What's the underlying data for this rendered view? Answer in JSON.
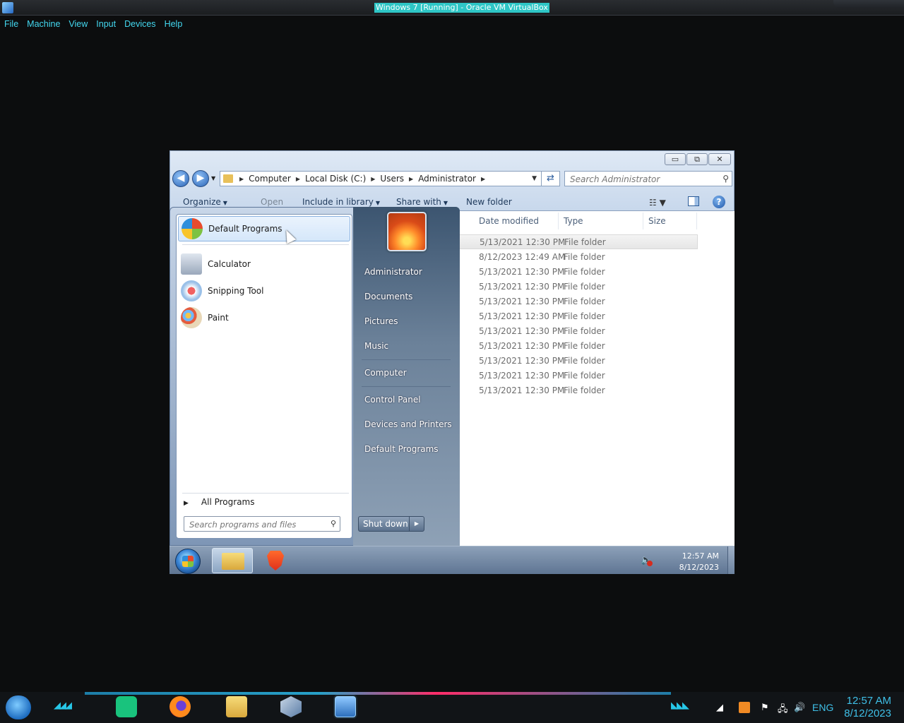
{
  "host": {
    "window_title": "Windows 7 [Running] - Oracle VM VirtualBox",
    "menu": [
      "File",
      "Machine",
      "View",
      "Input",
      "Devices",
      "Help"
    ],
    "tray": {
      "language": "ENG",
      "time": "12:57 AM",
      "date": "8/12/2023"
    }
  },
  "explorer": {
    "window_controls": {
      "minimize": "▭",
      "maximize": "⧉",
      "close": "✕"
    },
    "breadcrumb": [
      "Computer",
      "Local Disk (C:)",
      "Users",
      "Administrator"
    ],
    "search_placeholder": "Search Administrator",
    "commands": {
      "organize": "Organize",
      "open": "Open",
      "include_in_library": "Include in library",
      "share_with": "Share with",
      "new_folder": "New folder"
    },
    "columns": {
      "date_modified": "Date modified",
      "type": "Type",
      "size": "Size"
    },
    "rows": [
      {
        "date": "5/13/2021 12:30 PM",
        "type": "File folder"
      },
      {
        "date": "8/12/2023 12:49 AM",
        "type": "File folder"
      },
      {
        "date": "5/13/2021 12:30 PM",
        "type": "File folder"
      },
      {
        "date": "5/13/2021 12:30 PM",
        "type": "File folder"
      },
      {
        "date": "5/13/2021 12:30 PM",
        "type": "File folder"
      },
      {
        "date": "5/13/2021 12:30 PM",
        "type": "File folder"
      },
      {
        "date": "5/13/2021 12:30 PM",
        "type": "File folder"
      },
      {
        "date": "5/13/2021 12:30 PM",
        "type": "File folder"
      },
      {
        "date": "5/13/2021 12:30 PM",
        "type": "File folder"
      },
      {
        "date": "5/13/2021 12:30 PM",
        "type": "File folder"
      },
      {
        "date": "5/13/2021 12:30 PM",
        "type": "File folder"
      }
    ]
  },
  "start_menu": {
    "programs": [
      "Default Programs",
      "Calculator",
      "Snipping Tool",
      "Paint"
    ],
    "all_programs": "All Programs",
    "search_placeholder": "Search programs and files",
    "right_items": {
      "administrator": "Administrator",
      "documents": "Documents",
      "pictures": "Pictures",
      "music": "Music",
      "computer": "Computer",
      "control_panel": "Control Panel",
      "devices_printers": "Devices and Printers",
      "default_programs": "Default Programs"
    },
    "shut_down": "Shut down"
  },
  "vm_taskbar": {
    "time": "12:57 AM",
    "date": "8/12/2023"
  }
}
